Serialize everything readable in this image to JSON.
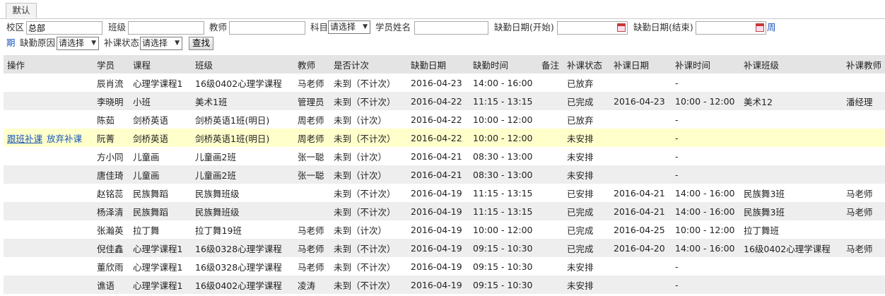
{
  "tab": {
    "label": "默认"
  },
  "filters": {
    "campus_label": "校区",
    "campus_value": "总部",
    "class_label": "班级",
    "class_value": "",
    "teacher_label": "教师",
    "teacher_value": "",
    "subject_label": "科目",
    "subject_value": "请选择",
    "student_label": "学员姓名",
    "student_value": "",
    "date_start_label": "缺勤日期(开始)",
    "date_end_label": "缺勤日期(结束)",
    "period_link_a": "周",
    "period_link_b": "期",
    "reason_label": "缺勤原因",
    "reason_value": "请选择",
    "status_label": "补课状态",
    "status_value": "请选择",
    "search_button": "查找"
  },
  "table": {
    "headers": [
      "操作",
      "学员",
      "课程",
      "班级",
      "教师",
      "是否计次",
      "缺勤日期",
      "缺勤时间",
      "备注",
      "补课状态",
      "补课日期",
      "补课时间",
      "补课班级",
      "补课教师"
    ],
    "rows": [
      {
        "actions": [],
        "student": "辰肖流",
        "course": "心理学课程1",
        "class": "16级0402心理学课程",
        "teacher": "马老师",
        "count": "未到（不计次）",
        "date": "2016-04-23",
        "time": "14:00 - 16:00",
        "note": "",
        "status": "已放弃",
        "mk_date": "",
        "mk_time": "-",
        "mk_class": "",
        "mk_teacher": ""
      },
      {
        "actions": [],
        "student": "李晓明",
        "course": "小班",
        "class": "美术1班",
        "teacher": "管理员",
        "count": "未到（不计次）",
        "date": "2016-04-22",
        "time": "11:15 - 13:15",
        "note": "",
        "status": "已完成",
        "mk_date": "2016-04-23",
        "mk_time": "10:00 - 12:00",
        "mk_class": "美术12",
        "mk_teacher": "潘经理"
      },
      {
        "actions": [],
        "student": "陈茹",
        "course": "剑桥英语",
        "class": "剑桥英语1班(明日)",
        "teacher": "周老师",
        "count": "未到（计次）",
        "date": "2016-04-22",
        "time": "10:00 - 12:00",
        "note": "",
        "status": "已放弃",
        "mk_date": "",
        "mk_time": "-",
        "mk_class": "",
        "mk_teacher": ""
      },
      {
        "actions": [
          "跟班补课",
          "放弃补课"
        ],
        "student": "阮菁",
        "course": "剑桥英语",
        "class": "剑桥英语1班(明日)",
        "teacher": "周老师",
        "count": "未到（不计次）",
        "date": "2016-04-22",
        "time": "10:00 - 12:00",
        "note": "",
        "status": "未安排",
        "mk_date": "",
        "mk_time": "-",
        "mk_class": "",
        "mk_teacher": ""
      },
      {
        "actions": [],
        "student": "方小同",
        "course": "儿童画",
        "class": "儿童画2班",
        "teacher": "张一聪",
        "count": "未到（计次）",
        "date": "2016-04-21",
        "time": "08:30 - 13:00",
        "note": "",
        "status": "未安排",
        "mk_date": "",
        "mk_time": "-",
        "mk_class": "",
        "mk_teacher": ""
      },
      {
        "actions": [],
        "student": "唐佳琦",
        "course": "儿童画",
        "class": "儿童画2班",
        "teacher": "张一聪",
        "count": "未到（计次）",
        "date": "2016-04-21",
        "time": "08:30 - 13:00",
        "note": "",
        "status": "未安排",
        "mk_date": "",
        "mk_time": "-",
        "mk_class": "",
        "mk_teacher": ""
      },
      {
        "actions": [],
        "student": "赵铭蕊",
        "course": "民族舞蹈",
        "class": "民族舞班级",
        "teacher": "",
        "count": "未到（不计次）",
        "date": "2016-04-19",
        "time": "11:15 - 13:15",
        "note": "",
        "status": "已安排",
        "mk_date": "2016-04-21",
        "mk_time": "14:00 - 16:00",
        "mk_class": "民族舞3班",
        "mk_teacher": "马老师"
      },
      {
        "actions": [],
        "student": "杨泽清",
        "course": "民族舞蹈",
        "class": "民族舞班级",
        "teacher": "",
        "count": "未到（不计次）",
        "date": "2016-04-19",
        "time": "11:15 - 13:15",
        "note": "",
        "status": "已完成",
        "mk_date": "2016-04-21",
        "mk_time": "14:00 - 16:00",
        "mk_class": "民族舞3班",
        "mk_teacher": "马老师"
      },
      {
        "actions": [],
        "student": "张瀚英",
        "course": "拉丁舞",
        "class": "拉丁舞19班",
        "teacher": "马老师",
        "count": "未到（计次）",
        "date": "2016-04-19",
        "time": "10:00 - 12:00",
        "note": "",
        "status": "已完成",
        "mk_date": "2016-04-25",
        "mk_time": "10:00 - 12:00",
        "mk_class": "拉丁舞班",
        "mk_teacher": ""
      },
      {
        "actions": [],
        "student": "倪佳鑫",
        "course": "心理学课程1",
        "class": "16级0328心理学课程",
        "teacher": "马老师",
        "count": "未到（不计次）",
        "date": "2016-04-19",
        "time": "09:15 - 10:30",
        "note": "",
        "status": "已完成",
        "mk_date": "2016-04-20",
        "mk_time": "14:00 - 16:00",
        "mk_class": "16级0402心理学课程",
        "mk_teacher": "马老师"
      },
      {
        "actions": [],
        "student": "董欣雨",
        "course": "心理学课程1",
        "class": "16级0328心理学课程",
        "teacher": "马老师",
        "count": "未到（不计次）",
        "date": "2016-04-19",
        "time": "09:15 - 10:30",
        "note": "",
        "status": "未安排",
        "mk_date": "",
        "mk_time": "-",
        "mk_class": "",
        "mk_teacher": ""
      },
      {
        "actions": [],
        "student": "谯语",
        "course": "心理学课程1",
        "class": "16级0402心理学课程",
        "teacher": "凌涛",
        "count": "未到（不计次）",
        "date": "2016-04-19",
        "time": "09:15 - 10:30",
        "note": "",
        "status": "未安排",
        "mk_date": "",
        "mk_time": "-",
        "mk_class": "",
        "mk_teacher": ""
      }
    ]
  },
  "colors": {
    "header_bg": "#e4e4e4",
    "row_alt": "#eeeeee",
    "row_highlight": "#ffffcc",
    "link": "#1a56b8"
  }
}
